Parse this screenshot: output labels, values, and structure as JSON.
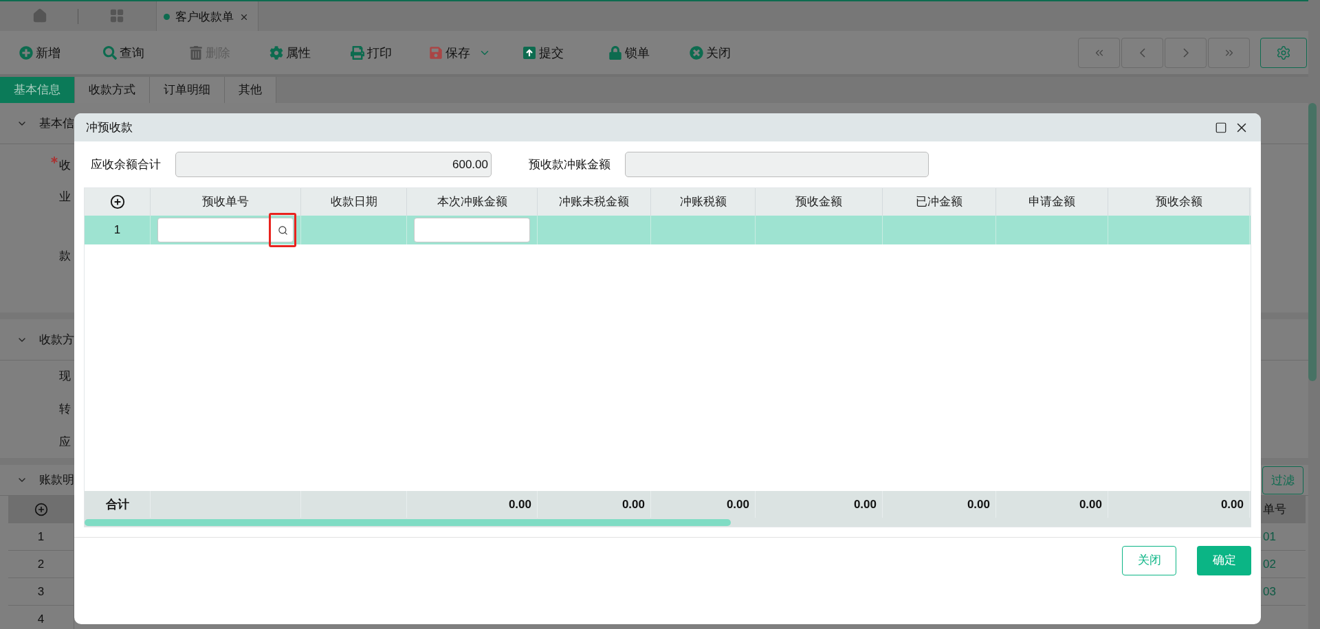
{
  "open_tabs": [
    {
      "label": "客户收款单",
      "selected": true
    }
  ],
  "toolbar": [
    {
      "label": "新增",
      "disabled": false
    },
    {
      "label": "查询",
      "disabled": false
    },
    {
      "label": "删除",
      "disabled": true
    },
    {
      "label": "属性",
      "disabled": false
    },
    {
      "label": "打印",
      "disabled": false
    },
    {
      "label": "保存",
      "disabled": false,
      "has_menu": true
    },
    {
      "label": "提交",
      "disabled": false
    },
    {
      "label": "锁单",
      "disabled": false
    },
    {
      "label": "关闭",
      "disabled": false
    }
  ],
  "form_tabs": [
    {
      "label": "基本信息",
      "selected": true
    },
    {
      "label": "收款方式",
      "selected": false
    },
    {
      "label": "订单明细",
      "selected": false
    },
    {
      "label": "其他",
      "selected": false
    }
  ],
  "sections": [
    {
      "title": "基本信",
      "fields": [
        {
          "label": "收",
          "required": true
        },
        {
          "label": "业",
          "required": false
        },
        {
          "label": "款",
          "required": false
        }
      ]
    },
    {
      "title": "收款方",
      "fields": [
        {
          "label": "现",
          "required": false
        },
        {
          "label": "转",
          "required": false
        },
        {
          "label": "应",
          "required": false
        }
      ]
    },
    {
      "title": "账款明",
      "filter_button": "过滤",
      "table": {
        "column_2": "单号",
        "rows": [
          {
            "index": "1",
            "column_2": "01"
          },
          {
            "index": "2",
            "column_2": "02"
          },
          {
            "index": "3",
            "column_2": "03"
          },
          {
            "index": "4"
          }
        ]
      }
    }
  ],
  "dialog": {
    "title": "冲预收款",
    "summary": [
      {
        "label": "应收余额合计",
        "value": "600.00"
      },
      {
        "label": "预收款冲账金额"
      }
    ],
    "columns": [
      {
        "title": "预收单号",
        "kind": "lookup"
      },
      {
        "title": "收款日期",
        "kind": "plain"
      },
      {
        "title": "本次冲账金额",
        "kind": "input",
        "total": "0.00"
      },
      {
        "title": "冲账未税金额",
        "kind": "plain",
        "total": "0.00"
      },
      {
        "title": "冲账税额",
        "kind": "plain",
        "total": "0.00"
      },
      {
        "title": "预收金额",
        "kind": "plain",
        "total": "0.00"
      },
      {
        "title": "已冲金额",
        "kind": "plain",
        "total": "0.00"
      },
      {
        "title": "申请金额",
        "kind": "plain",
        "total": "0.00"
      },
      {
        "title": "预收余额",
        "kind": "plain",
        "total": "0.00"
      }
    ],
    "rows": [
      {
        "index": "1",
        "selected": true,
        "lookup_highlighted": true
      }
    ],
    "totals_label": "合计",
    "buttons": [
      {
        "label": "关闭",
        "kind": "secondary"
      },
      {
        "label": "确定",
        "kind": "primary"
      }
    ]
  }
}
